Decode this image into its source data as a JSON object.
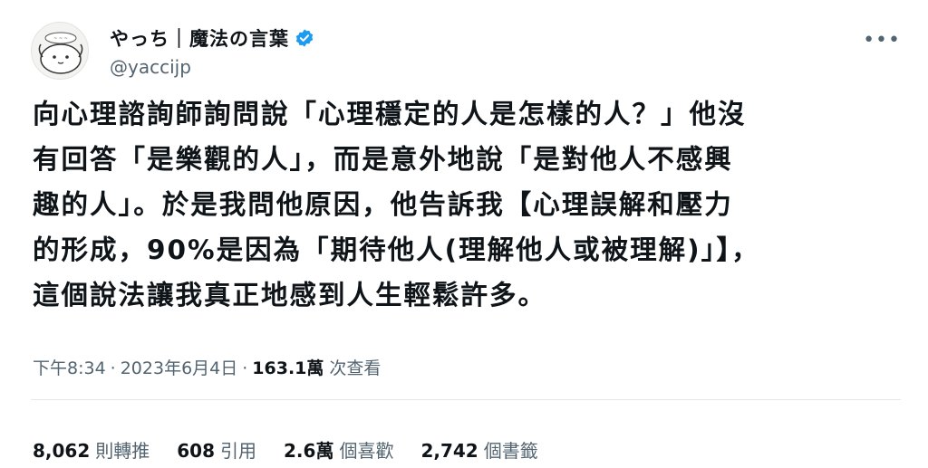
{
  "author": {
    "display_name": "やっち｜魔法の言葉",
    "handle": "@yaccijp",
    "avatar_icon": "avatar-cartoon-icon",
    "verified_icon": "verified-badge-icon",
    "verified_color": "#1d9bf0"
  },
  "more_icon": "more-options-icon",
  "more_glyph": "•••",
  "tweet": {
    "text": "向心理諮詢師詢問說「心理穩定的人是怎樣的人？」他沒\n有回答「是樂觀的人」，而是意外地說「是對他人不感興\n趣的人」。於是我問他原因，他告訴我【心理誤解和壓力\n的形成，90%是因為「期待他人(理解他人或被理解)」】，\n這個說法讓我真正地感到人生輕鬆許多。"
  },
  "meta": {
    "time": "下午8:34",
    "dot1": "·",
    "date": "2023年6月4日",
    "dot2": "·",
    "views_count": "163.1萬",
    "views_label": "次查看"
  },
  "stats": {
    "retweets_count": "8,062",
    "retweets_label": "則轉推",
    "quotes_count": "608",
    "quotes_label": "引用",
    "likes_count": "2.6萬",
    "likes_label": "個喜歡",
    "bookmarks_count": "2,742",
    "bookmarks_label": "個書籤"
  }
}
